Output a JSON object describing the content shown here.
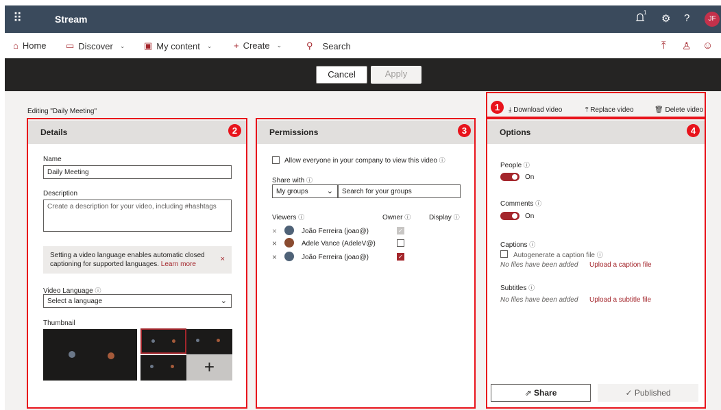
{
  "topbar": {
    "app_name": "Stream",
    "notification_count": "1",
    "avatar_initials": "JF"
  },
  "nav": {
    "home": "Home",
    "discover": "Discover",
    "my_content": "My content",
    "create": "Create",
    "search": "Search"
  },
  "actions": {
    "cancel": "Cancel",
    "apply": "Apply"
  },
  "editing_label": "Editing \"Daily Meeting\"",
  "badges": [
    "1",
    "2",
    "3",
    "4"
  ],
  "toolbar": {
    "download": "Download video",
    "replace": "Replace video",
    "delete": "Delete video"
  },
  "details": {
    "title": "Details",
    "name_label": "Name",
    "name_value": "Daily Meeting",
    "description_label": "Description",
    "description_placeholder": "Create a description for your video, including #hashtags",
    "notice_text": "Setting a video language enables automatic closed captioning for supported languages.",
    "notice_link": "Learn more",
    "notice_close": "×",
    "language_label": "Video Language",
    "language_value": "Select a language",
    "thumbnail_label": "Thumbnail",
    "add_thumbnail": "+"
  },
  "permissions": {
    "title": "Permissions",
    "allow_everyone": "Allow everyone in your company to view this video",
    "share_with_label": "Share with",
    "share_scope": "My groups",
    "search_placeholder": "Search for your groups",
    "col_viewers": "Viewers",
    "col_owner": "Owner",
    "col_display": "Display",
    "viewers": [
      {
        "name": "João Ferreira (joao@)",
        "owner": "disabled-checked"
      },
      {
        "name": "Adele Vance (AdeleV@)",
        "owner": "unchecked"
      },
      {
        "name": "João Ferreira (joao@)",
        "owner": "checked"
      }
    ]
  },
  "options": {
    "title": "Options",
    "people_label": "People",
    "people_state": "On",
    "comments_label": "Comments",
    "comments_state": "On",
    "captions_label": "Captions",
    "autogenerate_label": "Autogenerate a caption file",
    "captions_empty": "No files have been added",
    "captions_upload": "Upload a caption file",
    "subtitles_label": "Subtitles",
    "subtitles_empty": "No files have been added",
    "subtitles_upload": "Upload a subtitle file",
    "share_button": "Share",
    "published_button": "Published"
  },
  "colors": {
    "accent": "#a4262c",
    "highlight": "#e8131b",
    "topbar": "#3a4a5c"
  }
}
